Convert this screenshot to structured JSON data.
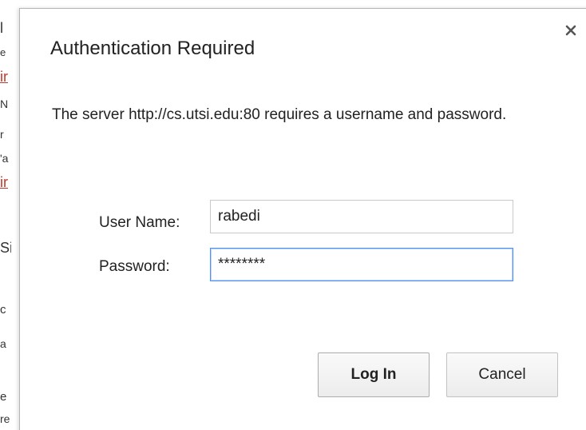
{
  "background_fragments": [
    {
      "text": "l",
      "link": false
    },
    {
      "text": "e",
      "link": false
    },
    {
      "text": "ir",
      "link": true
    },
    {
      "text": "N",
      "link": false
    },
    {
      "text": "r",
      "link": false
    },
    {
      "text": "'a",
      "link": false
    },
    {
      "text": "ir",
      "link": true
    },
    {
      "text": "Si",
      "link": false
    },
    {
      "text": "c",
      "link": false
    },
    {
      "text": "a",
      "link": false
    },
    {
      "text": "e",
      "link": false
    },
    {
      "text": "re",
      "link": false
    }
  ],
  "dialog": {
    "title": "Authentication Required",
    "message": "The server http://cs.utsi.edu:80 requires a username and password.",
    "close_icon": "×",
    "fields": {
      "username": {
        "label": "User Name:",
        "value": "rabedi"
      },
      "password": {
        "label": "Password:",
        "value": "********"
      }
    },
    "buttons": {
      "login": "Log In",
      "cancel": "Cancel"
    }
  }
}
